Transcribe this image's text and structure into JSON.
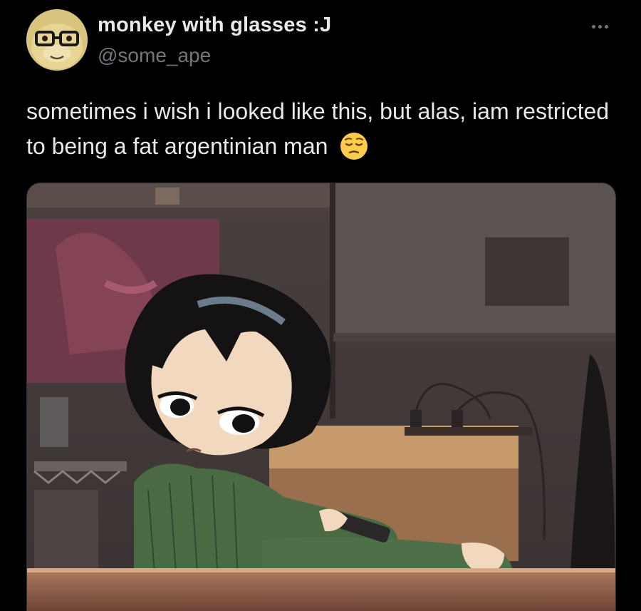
{
  "post": {
    "author": {
      "display_name": "monkey with glasses :J",
      "handle": "@some_ape"
    },
    "text": "sometimes i wish i looked like this, but alas, iam restricted to being a fat argentinian man",
    "text_emoji": "pensive-face",
    "media": {
      "kind": "image",
      "subject": "anime-girl-with-remote"
    }
  },
  "icons": {
    "more": "more-options-icon",
    "avatar": "monkey-with-glasses-avatar"
  },
  "colors": {
    "background": "#000000",
    "primary_text": "#e7e9ea",
    "secondary_text": "#71767b",
    "border": "#2f3336"
  }
}
